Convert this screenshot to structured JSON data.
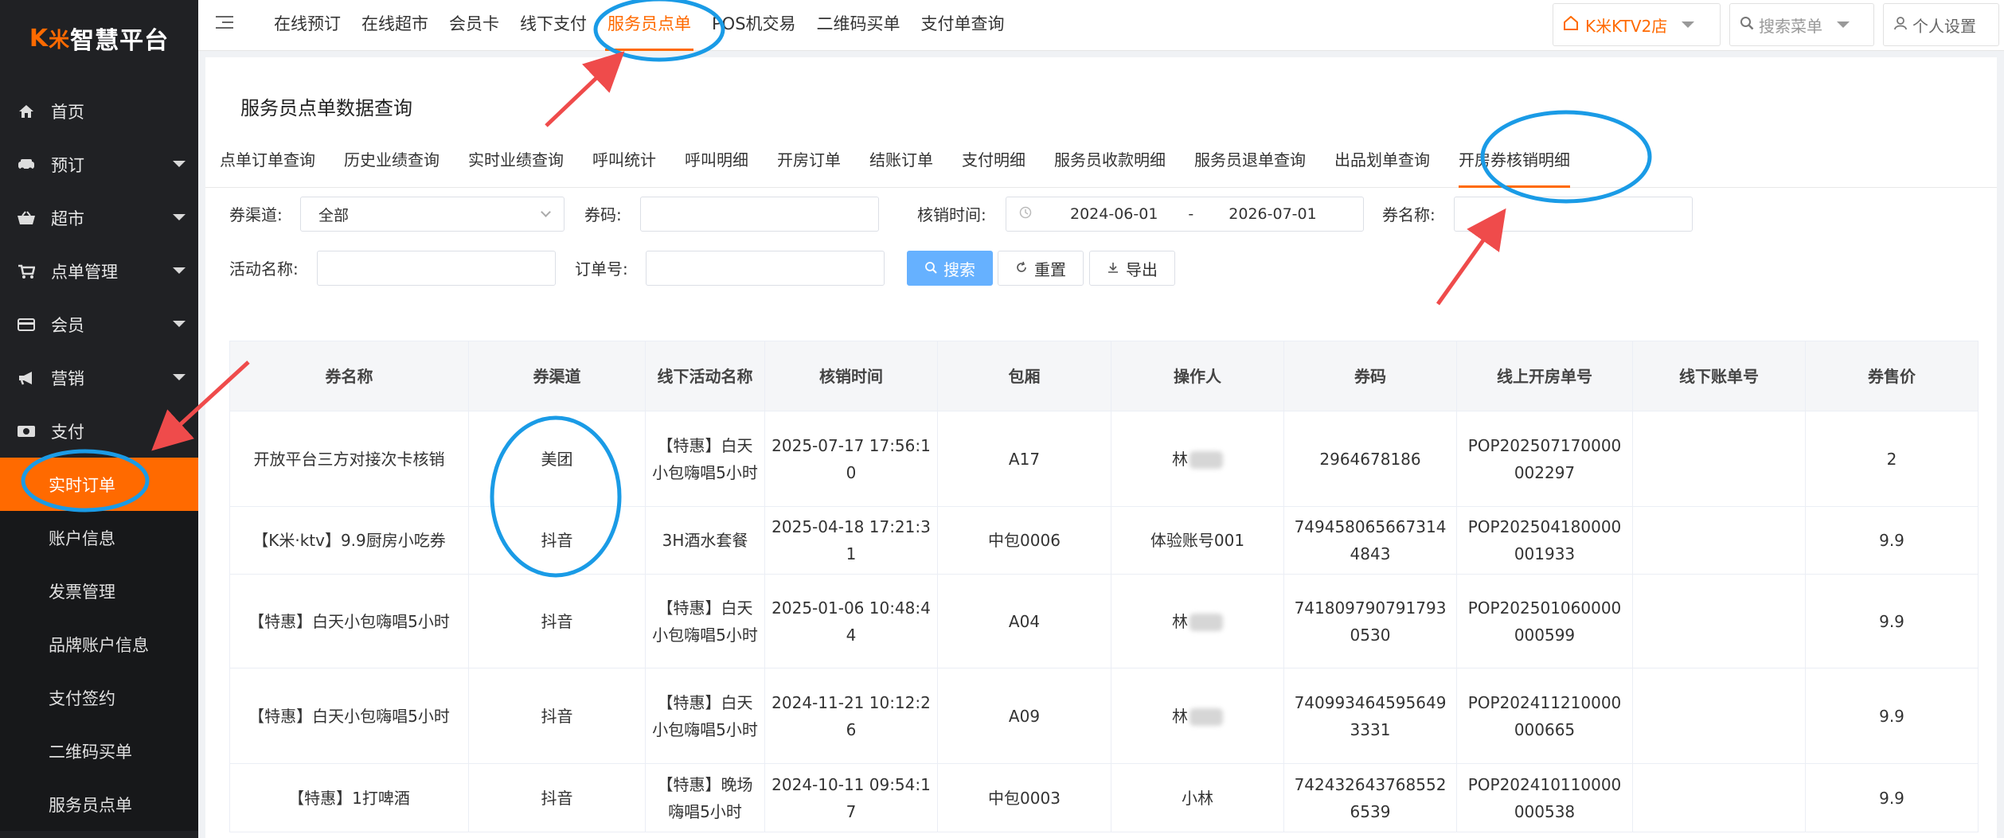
{
  "app": {
    "logo_prefix": "K",
    "logo_x": "米",
    "logo_name": "智慧平台"
  },
  "sidebar": {
    "items": [
      {
        "label": "首页",
        "icon": "home-icon"
      },
      {
        "label": "预订",
        "icon": "car-icon"
      },
      {
        "label": "超市",
        "icon": "basket-icon"
      },
      {
        "label": "点单管理",
        "icon": "cart-icon"
      },
      {
        "label": "会员",
        "icon": "card-icon"
      },
      {
        "label": "营销",
        "icon": "megaphone-icon"
      },
      {
        "label": "支付",
        "icon": "money-icon"
      }
    ],
    "sub_items": [
      "实时订单",
      "账户信息",
      "发票管理",
      "品牌账户信息",
      "支付签约",
      "二维码买单",
      "服务员点单"
    ]
  },
  "topnav": [
    "在线预订",
    "在线超市",
    "会员卡",
    "线下支付",
    "服务员点单",
    "POS机交易",
    "二维码买单",
    "支付单查询"
  ],
  "topbar": {
    "store": "K米KTV2店",
    "search_menu": "搜索菜单",
    "settings": "个人设置"
  },
  "page": {
    "title": "服务员点单数据查询"
  },
  "tabs": [
    "点单订单查询",
    "历史业绩查询",
    "实时业绩查询",
    "呼叫统计",
    "呼叫明细",
    "开房订单",
    "结账订单",
    "支付明细",
    "服务员收款明细",
    "服务员退单查询",
    "出品划单查询",
    "开房券核销明细"
  ],
  "filters": {
    "channel_label": "券渠道:",
    "channel_value": "全部",
    "code_label": "券码:",
    "time_label": "核销时间:",
    "date_start": "2024-06-01",
    "date_sep": "-",
    "date_end": "2026-07-01",
    "name_label": "券名称:",
    "activity_label": "活动名称:",
    "order_label": "订单号:",
    "search_btn": "搜索",
    "reset_btn": "重置",
    "export_btn": "导出"
  },
  "table": {
    "columns": [
      "券名称",
      "券渠道",
      "线下活动名称",
      "核销时间",
      "包厢",
      "操作人",
      "券码",
      "线上开房单号",
      "线下账单号",
      "券售价"
    ],
    "rows": [
      [
        "开放平台三方对接次卡核销",
        "美团",
        "【特惠】白天小包嗨唱5小时",
        "2025-07-17 17:56:10",
        "A17",
        "林",
        "2964678186",
        "POP202507170000002297",
        "",
        "2"
      ],
      [
        "【K米·ktv】9.9厨房小吃券",
        "抖音",
        "3H酒水套餐",
        "2025-04-18 17:21:31",
        "中包0006",
        "体验账号001",
        "7494580656673144843",
        "POP202504180000001933",
        "",
        "9.9"
      ],
      [
        "【特惠】白天小包嗨唱5小时",
        "抖音",
        "【特惠】白天小包嗨唱5小时",
        "2025-01-06 10:48:44",
        "A04",
        "林",
        "7418097907917930530",
        "POP202501060000000599",
        "",
        "9.9"
      ],
      [
        "【特惠】白天小包嗨唱5小时",
        "抖音",
        "【特惠】白天小包嗨唱5小时",
        "2024-11-21 10:12:26",
        "A09",
        "林",
        "7409934645956493331",
        "POP202411210000000665",
        "",
        "9.9"
      ],
      [
        "【特惠】1打啤酒",
        "抖音",
        "【特惠】晚场嗨唱5小时",
        "2024-10-11 09:54:17",
        "中包0003",
        "小林",
        "7424326437685526539",
        "POP202410110000000538",
        "",
        "9.9"
      ]
    ]
  },
  "colors": {
    "accent": "#ff6a00",
    "annotation": "#1a9be6",
    "arrow": "#ef4b4b",
    "sidebar_bg": "#202124"
  }
}
